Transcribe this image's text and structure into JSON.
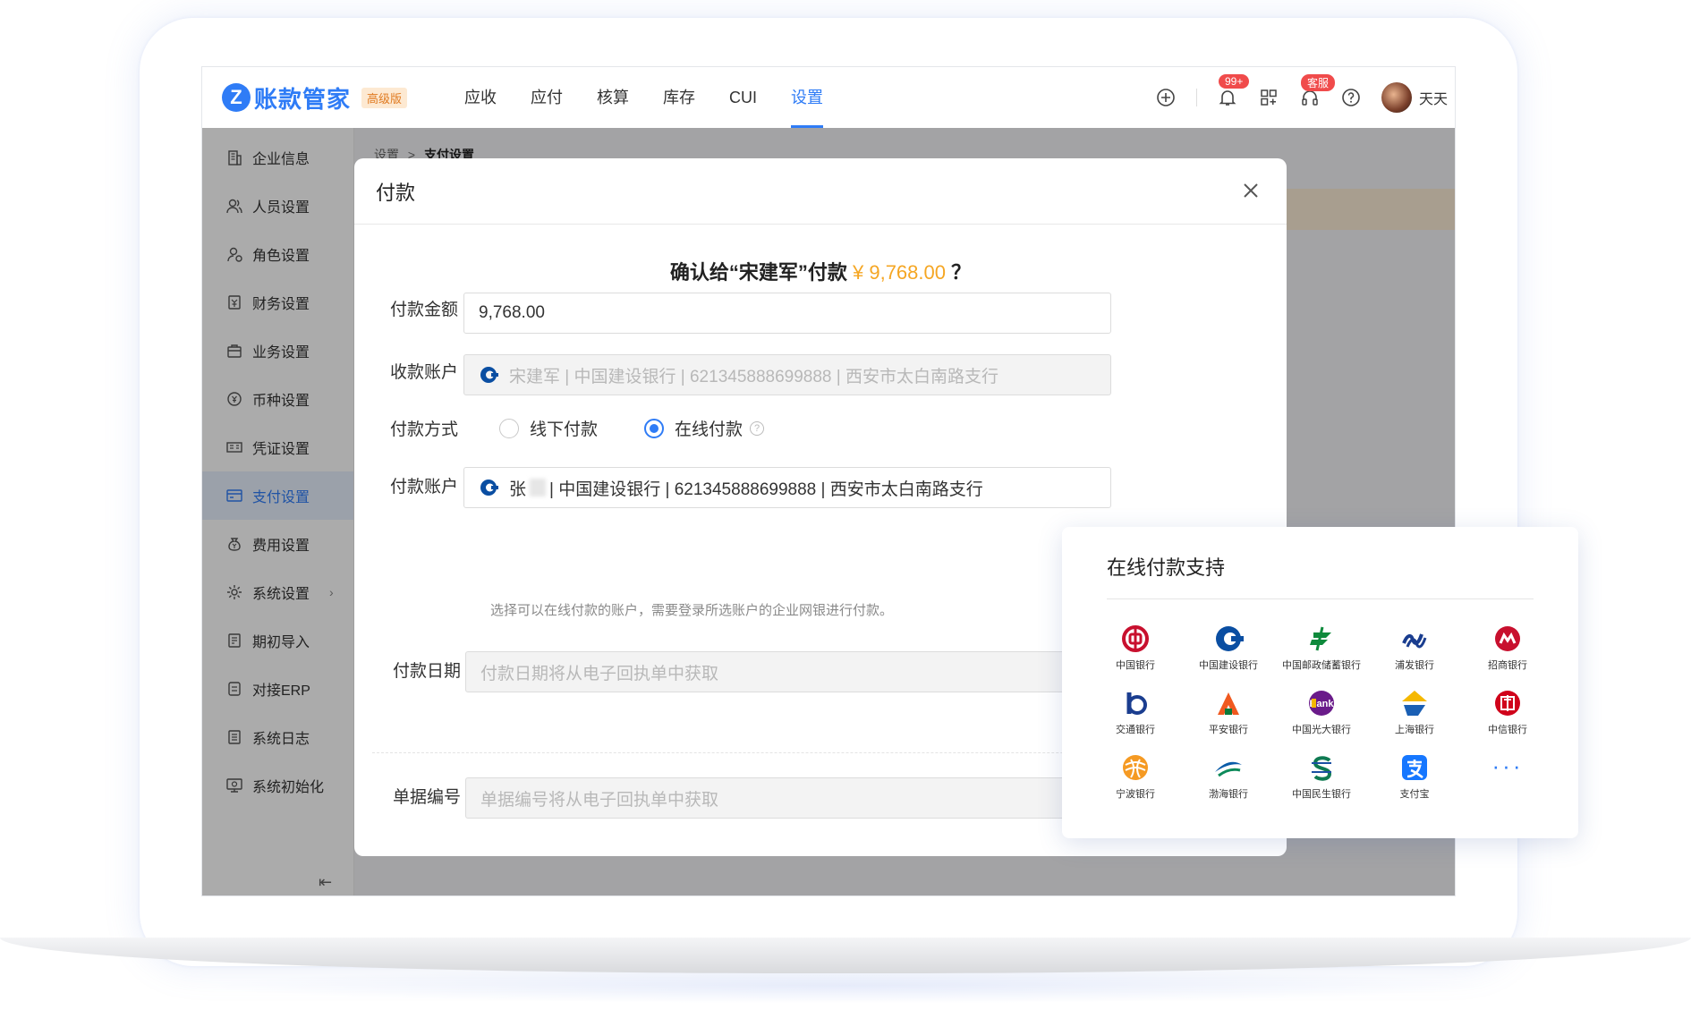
{
  "app": {
    "logo_mark": "Z",
    "name": "账款管家",
    "edition": "高级版",
    "nav": [
      "应收",
      "应付",
      "核算",
      "库存",
      "CUI",
      "设置"
    ],
    "nav_active": "设置",
    "notifications_badge": "99+",
    "service_badge": "客服",
    "user_name": "天天"
  },
  "sidebar": {
    "items": [
      {
        "label": "企业信息",
        "icon": "building-icon"
      },
      {
        "label": "人员设置",
        "icon": "users-icon"
      },
      {
        "label": "角色设置",
        "icon": "role-icon"
      },
      {
        "label": "财务设置",
        "icon": "finance-icon"
      },
      {
        "label": "业务设置",
        "icon": "briefcase-icon"
      },
      {
        "label": "币种设置",
        "icon": "currency-icon"
      },
      {
        "label": "凭证设置",
        "icon": "voucher-icon"
      },
      {
        "label": "支付设置",
        "icon": "card-icon",
        "active": true
      },
      {
        "label": "费用设置",
        "icon": "money-bag-icon"
      },
      {
        "label": "系统设置",
        "icon": "system-gear-icon",
        "has_children": true
      },
      {
        "label": "期初导入",
        "icon": "import-icon"
      },
      {
        "label": "对接ERP",
        "icon": "erp-icon"
      },
      {
        "label": "系统日志",
        "icon": "log-icon"
      },
      {
        "label": "系统初始化",
        "icon": "init-icon"
      }
    ]
  },
  "breadcrumb": {
    "root": "设置",
    "sep": ">",
    "current": "支付设置"
  },
  "modal": {
    "title": "付款",
    "confirm_prefix": "确认给“宋建军”付款",
    "confirm_amount": "¥ 9,768.00",
    "confirm_suffix": "？",
    "amount_label": "付款金额",
    "amount_value": "9,768.00",
    "receive_label": "收款账户",
    "receive_value": "宋建军 | 中国建设银行 | 621345888699888 | 西安市太白南路支行",
    "method_label": "付款方式",
    "method_offline": "线下付款",
    "method_online": "在线付款",
    "method_selected": "在线付款",
    "pay_account_label": "付款账户",
    "pay_account_name": "张",
    "pay_account_rest": "| 中国建设银行 | 621345888699888 | 西安市太白南路支行",
    "pay_account_hint": "选择可以在线付款的账户，需要登录所选账户的企业网银进行付款。",
    "date_label": "付款日期",
    "date_placeholder": "付款日期将从电子回执单中获取",
    "doc_label": "单据编号",
    "doc_placeholder": "单据编号将从电子回执单中获取"
  },
  "support_card": {
    "title": "在线付款支持",
    "banks": [
      {
        "name": "中国银行",
        "icon": "boc-icon",
        "color": "#c8102e"
      },
      {
        "name": "中国建设银行",
        "icon": "ccb-icon",
        "color": "#0a4ea2"
      },
      {
        "name": "中国邮政储蓄银行",
        "icon": "psbc-icon",
        "color": "#0f8a3c"
      },
      {
        "name": "浦发银行",
        "icon": "spdb-icon",
        "color": "#1a3d8f"
      },
      {
        "name": "招商银行",
        "icon": "cmb-icon",
        "color": "#c8102e"
      },
      {
        "name": "交通银行",
        "icon": "bocom-icon",
        "color": "#1a3d8f"
      },
      {
        "name": "平安银行",
        "icon": "pingan-icon",
        "color": "#f0591f"
      },
      {
        "name": "中国光大银行",
        "icon": "ceb-icon",
        "color": "#6a1b8a"
      },
      {
        "name": "上海银行",
        "icon": "bos-icon",
        "color": "#f5b800"
      },
      {
        "name": "中信银行",
        "icon": "citic-icon",
        "color": "#d0021b"
      },
      {
        "name": "宁波银行",
        "icon": "nbcb-icon",
        "color": "#f59a23"
      },
      {
        "name": "渤海银行",
        "icon": "cbhb-icon",
        "color": "#0a5ca8"
      },
      {
        "name": "中国民生银行",
        "icon": "cmbc-icon",
        "color": "#0f7a52"
      },
      {
        "name": "支付宝",
        "icon": "alipay-icon",
        "color": "#1677ff"
      }
    ],
    "more": "···"
  }
}
